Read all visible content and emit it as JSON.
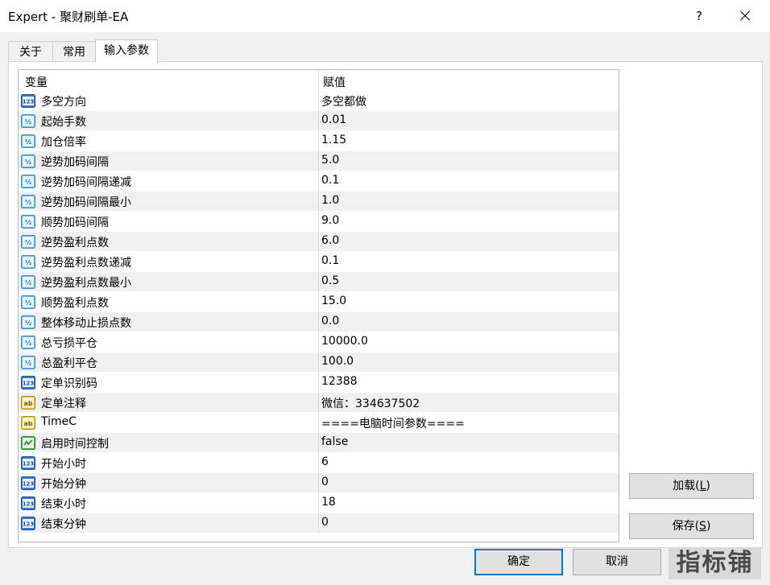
{
  "window": {
    "title": "Expert - 聚财刷单-EA",
    "help_label": "?"
  },
  "tabs": [
    {
      "label": "关于"
    },
    {
      "label": "常用"
    },
    {
      "label": "输入参数"
    }
  ],
  "grid": {
    "col_variable": "变量",
    "col_value": "赋值",
    "rows": [
      {
        "icon": "int-icon",
        "name": "多空方向",
        "value": "多空都做"
      },
      {
        "icon": "double-icon",
        "name": "起始手数",
        "value": "0.01"
      },
      {
        "icon": "double-icon",
        "name": "加仓倍率",
        "value": "1.15"
      },
      {
        "icon": "double-icon",
        "name": "逆势加码间隔",
        "value": "5.0"
      },
      {
        "icon": "double-icon",
        "name": "逆势加码间隔递减",
        "value": "0.1"
      },
      {
        "icon": "double-icon",
        "name": "逆势加码间隔最小",
        "value": "1.0"
      },
      {
        "icon": "double-icon",
        "name": "顺势加码间隔",
        "value": "9.0"
      },
      {
        "icon": "double-icon",
        "name": "逆势盈利点数",
        "value": "6.0"
      },
      {
        "icon": "double-icon",
        "name": "逆势盈利点数递减",
        "value": "0.1"
      },
      {
        "icon": "double-icon",
        "name": "逆势盈利点数最小",
        "value": "0.5"
      },
      {
        "icon": "double-icon",
        "name": "顺势盈利点数",
        "value": "15.0"
      },
      {
        "icon": "double-icon",
        "name": "整体移动止损点数",
        "value": "0.0"
      },
      {
        "icon": "double-icon",
        "name": "总亏损平仓",
        "value": "10000.0"
      },
      {
        "icon": "double-icon",
        "name": "总盈利平仓",
        "value": "100.0"
      },
      {
        "icon": "int-icon",
        "name": "定单识别码",
        "value": "12388"
      },
      {
        "icon": "string-icon",
        "name": "定单注释",
        "value": "微信：334637502"
      },
      {
        "icon": "string-icon",
        "name": "TimeC",
        "value": "====电脑时间参数===="
      },
      {
        "icon": "bool-icon",
        "name": "启用时间控制",
        "value": "false"
      },
      {
        "icon": "int-icon",
        "name": "开始小时",
        "value": "6"
      },
      {
        "icon": "int-icon",
        "name": "开始分钟",
        "value": "0"
      },
      {
        "icon": "int-icon",
        "name": "结束小时",
        "value": "18"
      },
      {
        "icon": "int-icon",
        "name": "结束分钟",
        "value": "0"
      }
    ]
  },
  "buttons": {
    "load": {
      "text": "加载(",
      "key": "L",
      "end": ")"
    },
    "save": {
      "text": "保存(",
      "key": "S",
      "end": ")"
    },
    "ok": "确定",
    "cancel": "取消"
  },
  "watermark": "指标铺",
  "colors": {
    "accent": "#0078d7",
    "row_alt": "#f0f0f0"
  }
}
